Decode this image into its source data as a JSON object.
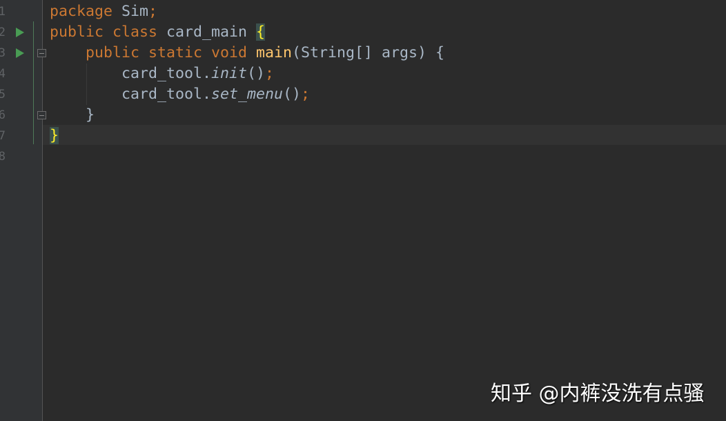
{
  "editor": {
    "line_numbers": [
      "1",
      "2",
      "3",
      "4",
      "5",
      "6",
      "7",
      "8"
    ],
    "current_line": 7,
    "lines": [
      [
        {
          "t": "package ",
          "c": "kw"
        },
        {
          "t": "Sim"
        },
        {
          "t": ";",
          "c": "kw"
        }
      ],
      [
        {
          "t": "public class ",
          "c": "kw"
        },
        {
          "t": "card_main "
        },
        {
          "t": "{",
          "c": "br"
        }
      ],
      [
        {
          "t": "    "
        },
        {
          "t": "public static void ",
          "c": "kw"
        },
        {
          "t": "main",
          "c": "fn"
        },
        {
          "t": "(String[] args) {"
        }
      ],
      [
        {
          "t": "        card_tool."
        },
        {
          "t": "init",
          "c": "it"
        },
        {
          "t": "()"
        },
        {
          "t": ";",
          "c": "kw"
        }
      ],
      [
        {
          "t": "        card_tool."
        },
        {
          "t": "set_menu",
          "c": "it"
        },
        {
          "t": "()"
        },
        {
          "t": ";",
          "c": "kw"
        }
      ],
      [
        {
          "t": "    }"
        }
      ],
      [
        {
          "t": "}",
          "c": "br"
        }
      ],
      [
        {
          "t": ""
        }
      ]
    ],
    "run_icon_lines": [
      2,
      3
    ],
    "fold_icon_lines": [
      3,
      6
    ]
  },
  "watermark": "知乎 @内裤没洗有点骚",
  "colors": {
    "background": "#2b2b2b",
    "keyword": "#cc7832",
    "function": "#ffc66d",
    "text": "#a9b7c6",
    "brace_match": "#ffef28",
    "run": "#499c54"
  }
}
